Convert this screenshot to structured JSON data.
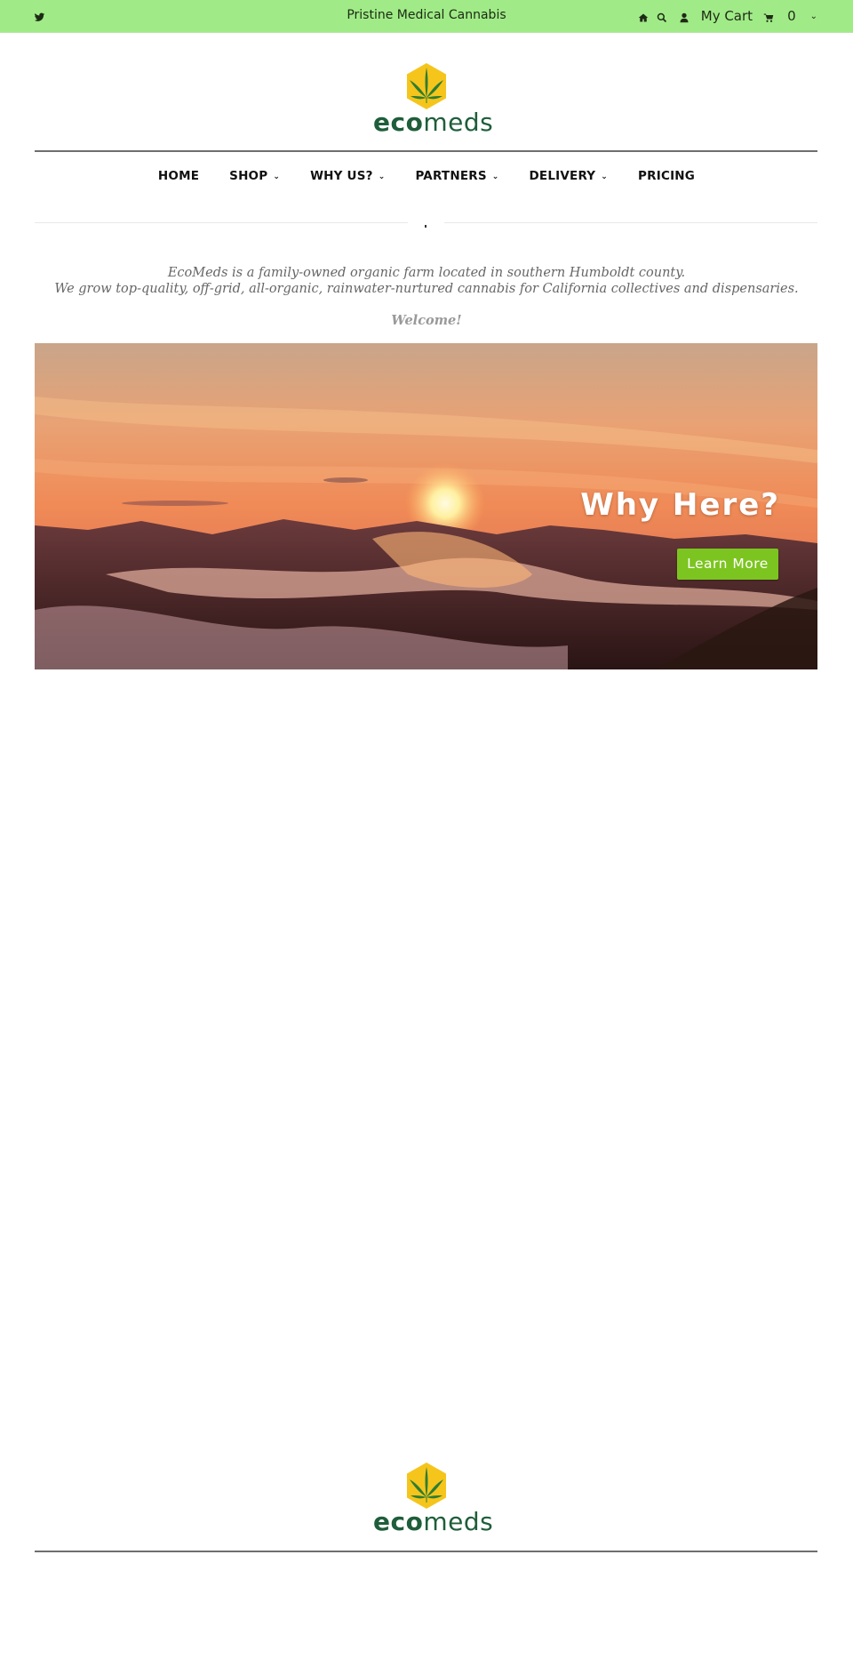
{
  "topbar": {
    "tagline": "Pristine Medical Cannabis",
    "icons": [
      "twitter-icon",
      "home-icon",
      "search-icon",
      "user-icon",
      "cart-icon",
      "chevron-down-icon"
    ],
    "cart_label": "My Cart",
    "cart_count": "0",
    "bg_color": "#a0eb87"
  },
  "logo": {
    "eco": "eco",
    "meds": "meds",
    "brand_green": "#1e5e3a",
    "hex_yellow": "#f5c51c"
  },
  "nav": {
    "items": [
      {
        "label": "HOME",
        "has_dropdown": false
      },
      {
        "label": "SHOP",
        "has_dropdown": true
      },
      {
        "label": "WHY US?",
        "has_dropdown": true
      },
      {
        "label": "PARTNERS",
        "has_dropdown": true
      },
      {
        "label": "DELIVERY",
        "has_dropdown": true
      },
      {
        "label": "PRICING",
        "has_dropdown": false
      }
    ],
    "dropdown_glyph": "⌄"
  },
  "intro": {
    "line1": "EcoMeds is a family-owned organic farm located in southern Humboldt county.",
    "line2": "We grow top-quality, off-grid, all-organic, rainwater-nurtured cannabis for California collectives and dispensaries.",
    "welcome": "Welcome!"
  },
  "hero": {
    "headline": "Why Here?",
    "cta_label": "Learn More",
    "cta_color": "#7cc520",
    "image_alt": "sunset over fog-covered hills"
  }
}
